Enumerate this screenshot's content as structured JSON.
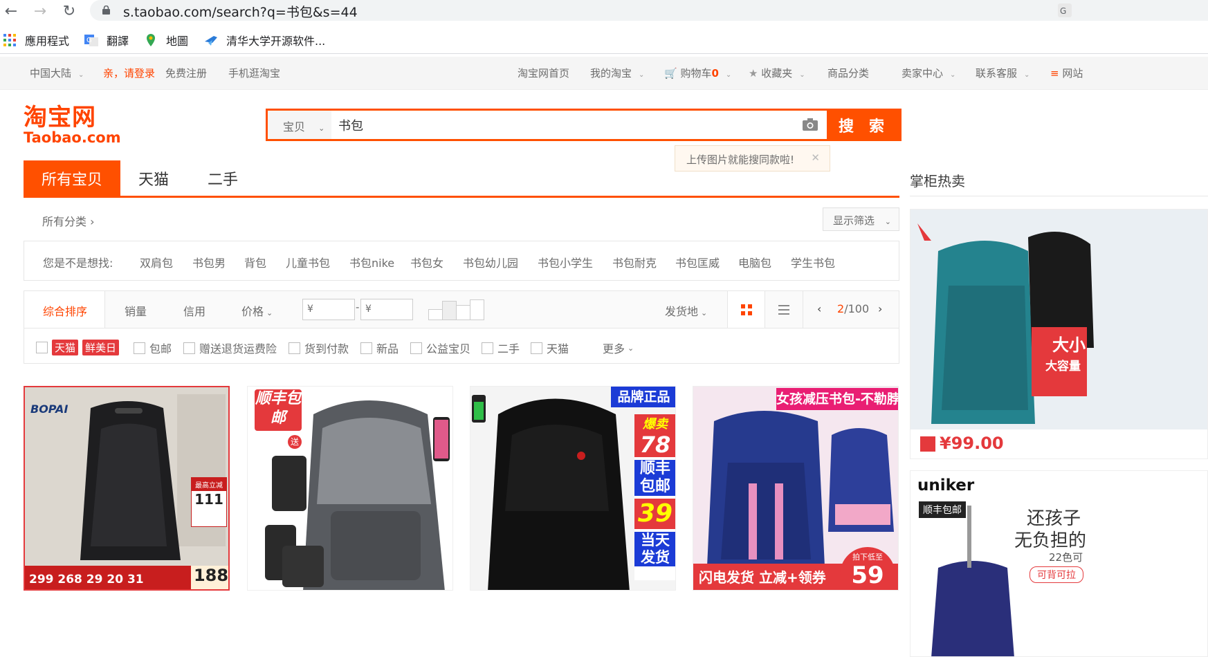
{
  "browser": {
    "url": "s.taobao.com/search?q=书包&s=44",
    "bookmarks": [
      "應用程式",
      "翻譯",
      "地圖",
      "清华大学开源软件..."
    ]
  },
  "site_nav": {
    "region": "中国大陆",
    "login": "亲，请登录",
    "register": "免费注册",
    "mobile": "手机逛淘宝",
    "home": "淘宝网首页",
    "my_taobao": "我的淘宝",
    "cart_label": "购物车",
    "cart_count": "0",
    "favorites": "收藏夹",
    "categories": "商品分类",
    "seller": "卖家中心",
    "service": "联系客服",
    "sitemap": "网站"
  },
  "logo": {
    "cn": "淘宝网",
    "en": "Taobao.com"
  },
  "search": {
    "scope": "宝贝",
    "query": "书包",
    "button": "搜 索",
    "tip": "上传图片就能搜同款啦!"
  },
  "tabs": [
    "所有宝贝",
    "天猫",
    "二手"
  ],
  "hot": {
    "title": "掌柜热卖",
    "price1": "¥99.00"
  },
  "category": {
    "all": "所有分类 ›",
    "filter_btn": "显示筛选"
  },
  "suggest": {
    "label": "您是不是想找:",
    "items": [
      "双肩包",
      "书包男",
      "背包",
      "儿童书包",
      "书包nike",
      "书包女",
      "书包幼儿园",
      "书包小学生",
      "书包耐克",
      "书包匡威",
      "电脑包",
      "学生书包"
    ]
  },
  "sort": {
    "items": [
      "综合排序",
      "销量",
      "信用",
      "价格"
    ],
    "price_from": "¥",
    "price_to": "¥",
    "location": "发货地",
    "page_current": "2",
    "page_total": "/100"
  },
  "filters": {
    "tmall": "天猫",
    "fresh": "鲜美日",
    "items": [
      "包邮",
      "赠送退货运费险",
      "货到付款",
      "新品",
      "公益宝贝",
      "二手",
      "天猫"
    ],
    "more": "更多"
  },
  "products": {
    "p1": {
      "brand": "BOPAI",
      "promo": "最高立减",
      "promo_val": "111",
      "price_main": "188",
      "prices": "299 268 29 20 31"
    },
    "p2": {
      "tag": "顺丰包邮",
      "gift": "送"
    },
    "p3": {
      "tag": "品牌正品",
      "hot": "爆卖",
      "price": "78",
      "sf": "顺丰包邮",
      "coupon": "39",
      "ship": "当天发货"
    },
    "p4": {
      "title": "女孩减压书包-不勒脖",
      "bottom": "闪电发货 立减+领券",
      "price": "59",
      "badge": "拍下低至"
    }
  },
  "side": {
    "banner1": "大小",
    "banner1b": "大容量",
    "brand2": "uniker",
    "sf2": "顺丰包邮",
    "text2a": "还孩子",
    "text2b": "无负担的",
    "colors2": "22色可",
    "tag2": "可背可拉"
  },
  "colors": {
    "accent": "#ff5000",
    "tmall_red": "#e4393c"
  }
}
